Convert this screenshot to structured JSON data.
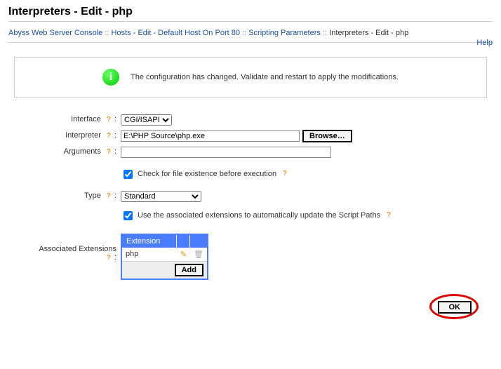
{
  "title": "Interpreters - Edit - php",
  "breadcrumb": {
    "b1": "Abyss Web Server Console",
    "b2": "Hosts - Edit - Default Host On Port 80",
    "b3": "Scripting Parameters",
    "b4": "Interpreters - Edit - php",
    "help": "Help"
  },
  "notice": "The configuration has changed. Validate and restart to apply the modifications.",
  "labels": {
    "interface": "Interface",
    "interpreter": "Interpreter",
    "arguments": "Arguments",
    "checkExist": "Check for file existence before execution",
    "type": "Type",
    "useAssoc": "Use the associated extensions to automatically update the Script Paths",
    "assocExt": "Associated Extensions"
  },
  "fields": {
    "interfaceOption": "CGI/ISAPI",
    "interpreterPath": "E:\\PHP Source\\php.exe",
    "browse": "Browse…",
    "arguments": "",
    "typeOption": "Standard"
  },
  "extTable": {
    "header": "Extension",
    "row1": "php",
    "addBtn": "Add"
  },
  "ok": "OK"
}
